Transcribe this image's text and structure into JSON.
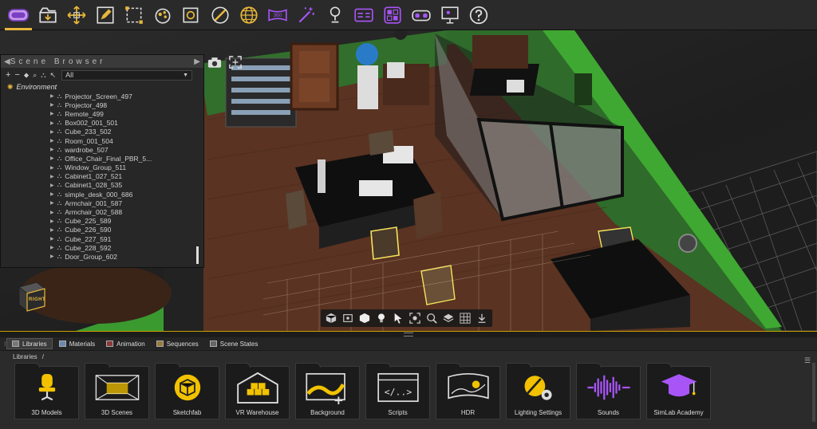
{
  "toolbar": {
    "icons": [
      "vr-headset-icon",
      "import-icon",
      "move-gizmo-icon",
      "edit-icon",
      "select-box-icon",
      "materials-icon",
      "camera-frame-icon",
      "slash-circle-icon",
      "globe-icon",
      "panorama-360-icon",
      "magic-wand-icon",
      "trophy-icon",
      "dashboard-icon",
      "widgets-icon",
      "vr-viewer-icon",
      "presentation-icon",
      "help-icon"
    ],
    "panorama_label": "360"
  },
  "scene_browser": {
    "title": "Scene Browser",
    "filter_value": "All",
    "root_label": "Environment",
    "items": [
      "Projector_Screen_497",
      "Projector_498",
      "Remote_499",
      "Box002_001_501",
      "Cube_233_502",
      "Room_001_504",
      "wardrobe_507",
      "Office_Chair_Final_PBR_5...",
      "Window_Group_511",
      "Cabinet1_027_521",
      "Cabinet1_028_535",
      "simple_desk_000_686",
      "Armchair_001_587",
      "Armchair_002_588",
      "Cube_225_589",
      "Cube_226_590",
      "Cube_227_591",
      "Cube_228_592",
      "Door_Group_602"
    ]
  },
  "view_cube": {
    "label": "RIGHT"
  },
  "panel": {
    "tabs": [
      "Libraries",
      "Materials",
      "Animation",
      "Sequences",
      "Scene States"
    ],
    "active_tab": "Libraries",
    "breadcrumb": [
      "Libraries",
      "/"
    ],
    "libraries": [
      {
        "label": "3D Models",
        "icon": "chair-icon"
      },
      {
        "label": "3D Scenes",
        "icon": "room-icon"
      },
      {
        "label": "Sketchfab",
        "icon": "sketchfab-icon"
      },
      {
        "label": "VR Warehouse",
        "icon": "warehouse-icon"
      },
      {
        "label": "Background",
        "icon": "background-icon"
      },
      {
        "label": "Scripts",
        "icon": "script-icon"
      },
      {
        "label": "HDR",
        "icon": "hdr-icon"
      },
      {
        "label": "Lighting Settings",
        "icon": "lighting-settings-icon"
      },
      {
        "label": "Sounds",
        "icon": "sound-wave-icon"
      },
      {
        "label": "SimLab Academy",
        "icon": "graduation-cap-icon"
      }
    ]
  },
  "colors": {
    "accent": "#e8b73a",
    "icon_purple": "#a855f7",
    "wall_green": "#2f6b2a",
    "floor_wood": "#5a3322"
  }
}
